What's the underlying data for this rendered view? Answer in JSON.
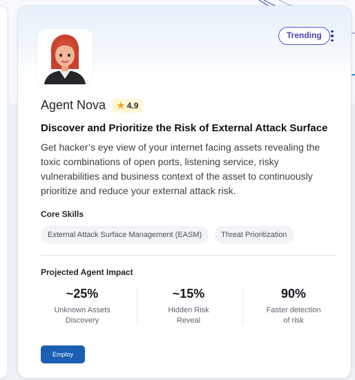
{
  "agent": {
    "name": "Agent Nova",
    "rating": "4.9",
    "badge": "Trending",
    "headline": "Discover and Prioritize the Risk of External Attack Surface",
    "description": "Get hacker’s eye view of your internet facing assets revealing the toxic combinations of open ports, listening service, risky vulnerabilities and business context of the asset to continuously prioritize and reduce your external attack risk."
  },
  "skills": {
    "label": "Core Skills",
    "items": [
      "External Attack Surface Management (EASM)",
      "Threat Prioritization"
    ]
  },
  "impact": {
    "label": "Projected Agent Impact",
    "metrics": [
      {
        "value": "~25%",
        "line1": "Unknown Assets",
        "line2": "Discovery"
      },
      {
        "value": "~15%",
        "line1": "Hidden Risk",
        "line2": "Reveal"
      },
      {
        "value": "90%",
        "line1": "Faster detection",
        "line2": "of risk"
      }
    ]
  },
  "actions": {
    "employ_label": "Employ"
  },
  "icons": {
    "star": "star-icon",
    "menu": "kebab-menu-icon"
  },
  "colors": {
    "accent": "#1a5fb4",
    "badge_border": "#5b4fc6",
    "rating_bg": "#fff6d6"
  }
}
